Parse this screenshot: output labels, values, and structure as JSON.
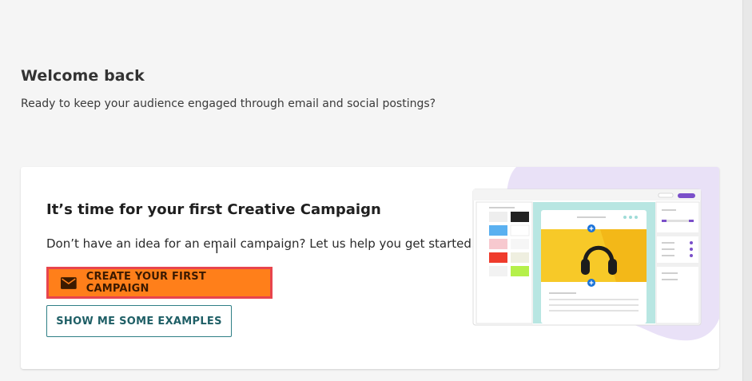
{
  "welcome": {
    "title": "Welcome back",
    "subtitle": "Ready to keep your audience engaged through email and social postings?"
  },
  "card": {
    "title": "It’s time for your first Creative Campaign",
    "text": "Don’t have an idea for an email campaign? Let us help you get started.",
    "primary_button": {
      "label": "CREATE YOUR FIRST CAMPAIGN",
      "icon": "envelope-icon"
    },
    "secondary_button": {
      "label": "SHOW ME SOME EXAMPLES"
    }
  },
  "colors": {
    "primary_button_bg": "#ff7f1a",
    "primary_button_border": "#e8454d",
    "secondary_button_border": "#2f7f86",
    "illustration_blob": "#e9e1f7",
    "illustration_teal": "#b8e6e2",
    "illustration_yellow": "#f7c928",
    "illustration_purple": "#7a4fc9"
  }
}
